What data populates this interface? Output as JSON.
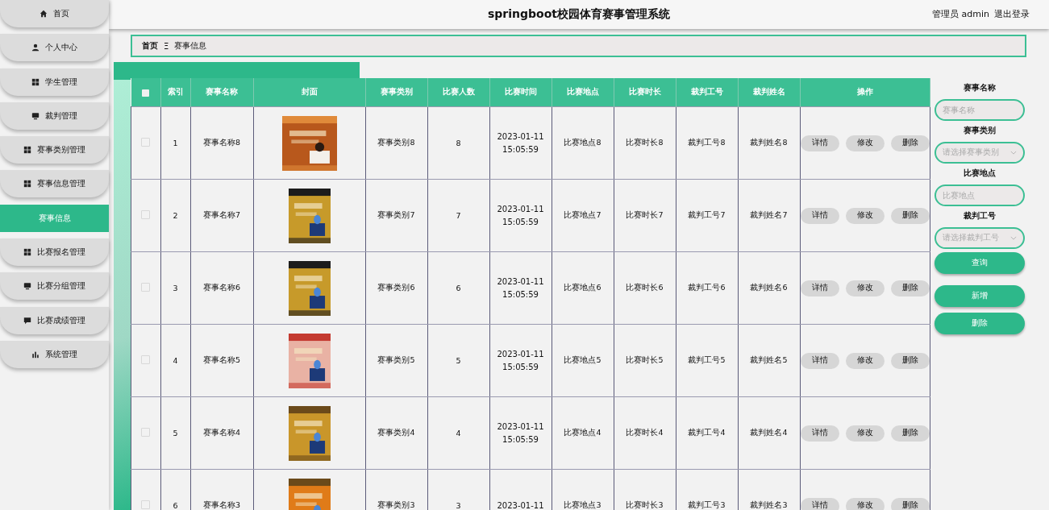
{
  "sidebar": {
    "items": [
      {
        "label": "首页",
        "selected": false
      },
      {
        "label": "个人中心",
        "selected": false
      },
      {
        "label": "学生管理",
        "selected": false
      },
      {
        "label": "裁判管理",
        "selected": false
      },
      {
        "label": "赛事类别管理",
        "selected": false
      },
      {
        "label": "赛事信息管理",
        "selected": false
      },
      {
        "label": "赛事信息",
        "selected": true
      },
      {
        "label": "比赛报名管理",
        "selected": false
      },
      {
        "label": "比赛分组管理",
        "selected": false
      },
      {
        "label": "比赛成绩管理",
        "selected": false
      },
      {
        "label": "系统管理",
        "selected": false
      }
    ]
  },
  "header": {
    "title": "springboot校园体育赛事管理系统",
    "user": "管理员 admin",
    "logout": "退出登录"
  },
  "breadcrumb": {
    "home": "首页",
    "separator": "Ξ",
    "current": "赛事信息"
  },
  "table": {
    "header_checked": false,
    "columns": [
      "索引",
      "赛事名称",
      "封面",
      "赛事类别",
      "比赛人数",
      "比赛时间",
      "比赛地点",
      "比赛时长",
      "裁判工号",
      "裁判姓名",
      "操作"
    ],
    "rows": [
      {
        "checked": false,
        "index": "1",
        "name": "赛事名称8",
        "category": "赛事类别8",
        "count": "8",
        "time": [
          "2023-01-11",
          "15:05:59"
        ],
        "place": "比赛地点8",
        "duration": "比赛时长8",
        "ref_id": "裁判工号8",
        "ref_name": "裁判姓名8",
        "actions": [
          "详情",
          "修改",
          "删除"
        ]
      },
      {
        "checked": false,
        "index": "2",
        "name": "赛事名称7",
        "category": "赛事类别7",
        "count": "7",
        "time": [
          "2023-01-11",
          "15:05:59"
        ],
        "place": "比赛地点7",
        "duration": "比赛时长7",
        "ref_id": "裁判工号7",
        "ref_name": "裁判姓名7",
        "actions": [
          "详情",
          "修改",
          "删除"
        ]
      },
      {
        "checked": false,
        "index": "3",
        "name": "赛事名称6",
        "category": "赛事类别6",
        "count": "6",
        "time": [
          "2023-01-11",
          "15:05:59"
        ],
        "place": "比赛地点6",
        "duration": "比赛时长6",
        "ref_id": "裁判工号6",
        "ref_name": "裁判姓名6",
        "actions": [
          "详情",
          "修改",
          "删除"
        ]
      },
      {
        "checked": false,
        "index": "4",
        "name": "赛事名称5",
        "category": "赛事类别5",
        "count": "5",
        "time": [
          "2023-01-11",
          "15:05:59"
        ],
        "place": "比赛地点5",
        "duration": "比赛时长5",
        "ref_id": "裁判工号5",
        "ref_name": "裁判姓名5",
        "actions": [
          "详情",
          "修改",
          "删除"
        ]
      },
      {
        "checked": false,
        "index": "5",
        "name": "赛事名称4",
        "category": "赛事类别4",
        "count": "4",
        "time": [
          "2023-01-11",
          "15:05:59"
        ],
        "place": "比赛地点4",
        "duration": "比赛时长4",
        "ref_id": "裁判工号4",
        "ref_name": "裁判姓名4",
        "actions": [
          "详情",
          "修改",
          "删除"
        ]
      },
      {
        "checked": false,
        "index": "6",
        "name": "赛事名称3",
        "category": "赛事类别3",
        "count": "3",
        "time": [
          "2023-01-11"
        ],
        "place": "比赛地点3",
        "duration": "比赛时长3",
        "ref_id": "裁判工号3",
        "ref_name": "裁判姓名3",
        "actions": [
          "详情",
          "修改",
          "删除"
        ]
      }
    ]
  },
  "search": {
    "fields": [
      {
        "kind": "input",
        "label": "赛事名称",
        "placeholder": "赛事名称"
      },
      {
        "kind": "select",
        "label": "赛事类别",
        "placeholder": "请选择赛事类别"
      },
      {
        "kind": "input",
        "label": "比赛地点",
        "placeholder": "比赛地点"
      },
      {
        "kind": "select",
        "label": "裁判工号",
        "placeholder": "请选择裁判工号"
      }
    ],
    "query": "查询",
    "add": "新增",
    "delete": "删除"
  }
}
